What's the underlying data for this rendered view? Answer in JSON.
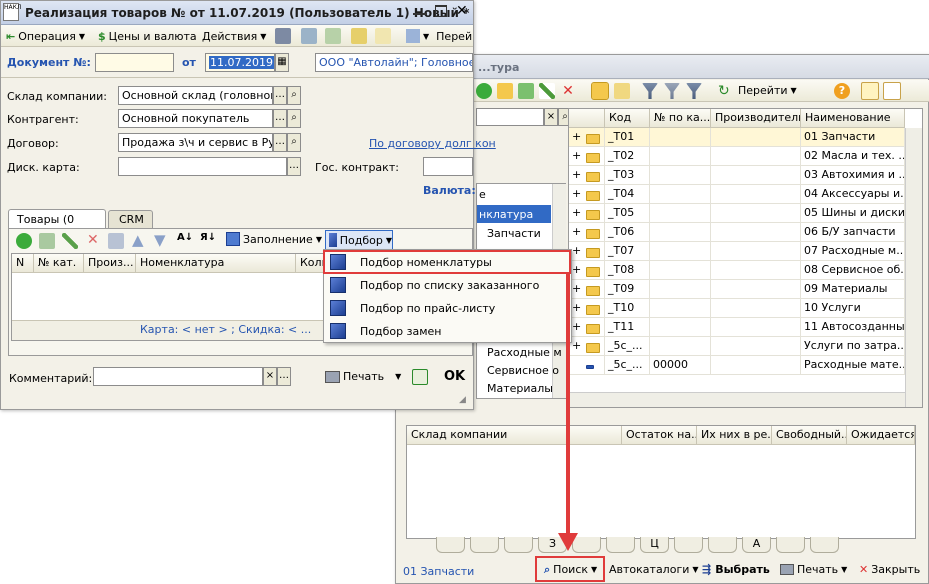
{
  "doc": {
    "title": "Реализация товаров №  от 11.07.2019 (Пользователь 1) Новый *",
    "toolbar": {
      "operation": "Операция",
      "prices": "Цены и валюта",
      "actions": "Действия",
      "goto": "Перей"
    },
    "number_label": "Документ №:",
    "date_label": "от",
    "date_value": "11.07.2019",
    "org_value": "ООО \"Автолайн\"; Головное по",
    "warehouse_label": "Склад компании:",
    "warehouse_value": "Основной склад (головной)",
    "contractor_label": "Контрагент:",
    "contractor_value": "Основной покупатель",
    "contract_label": "Договор:",
    "contract_value": "Продажа з\\ч и сервис в Руб о",
    "contract_link": "По договору долг кон",
    "card_label": "Диск. карта:",
    "gov_label": "Гос. контракт:",
    "currency_label": "Валюта:",
    "tabs": {
      "goods": "Товары (0 поз.)",
      "crm": "CRM"
    },
    "grid_toolbar": {
      "fill": "Заполнение",
      "pick": "Подбор"
    },
    "columns": {
      "n": "N",
      "cat": "№ кат.",
      "maker": "Произ...",
      "item": "Номенклатура",
      "qty": "Коли"
    },
    "footer_info": "Карта:  < нет > ; Скидка:  < ...",
    "comment_label": "Комментарий:",
    "print_label": "Печать",
    "ok_label": "OK"
  },
  "menu": {
    "items": [
      "Подбор номенклатуры",
      "Подбор по списку заказанного",
      "Подбор по прайс-листу",
      "Подбор замен"
    ]
  },
  "catalog": {
    "title": "...тура",
    "toolbar": {
      "goto": "Перейти"
    },
    "tree_items": [
      "нклатура",
      "Запчасти",
      "Расходные м",
      "Сервисное о",
      "Материалы"
    ],
    "tree_header_fragment": "е",
    "columns": {
      "code": "Код",
      "cat": "№ по ка...",
      "maker": "Производитель",
      "name": "Наименование"
    },
    "rows": [
      {
        "code": "_T01",
        "cat": "",
        "name": "01 Запчасти"
      },
      {
        "code": "_T02",
        "cat": "",
        "name": "02 Масла и тех. ..."
      },
      {
        "code": "_T03",
        "cat": "",
        "name": "03 Автохимия и ..."
      },
      {
        "code": "_T04",
        "cat": "",
        "name": "04 Аксессуары и..."
      },
      {
        "code": "_T05",
        "cat": "",
        "name": "05 Шины и диски"
      },
      {
        "code": "_T06",
        "cat": "",
        "name": "06 Б/У запчасти"
      },
      {
        "code": "_T07",
        "cat": "",
        "name": "07 Расходные м..."
      },
      {
        "code": "_T08",
        "cat": "",
        "name": "08 Сервисное об..."
      },
      {
        "code": "_T09",
        "cat": "",
        "name": "09 Материалы"
      },
      {
        "code": "_T10",
        "cat": "",
        "name": "10 Услуги"
      },
      {
        "code": "_T11",
        "cat": "",
        "name": "11 Автосозданные"
      },
      {
        "code": "_5c_...",
        "cat": "",
        "name": "Услуги по затра..."
      },
      {
        "code": "_5c_...",
        "cat": "00000",
        "name": "Расходные мате..."
      }
    ],
    "stock_columns": {
      "warehouse": "Склад компании",
      "rest": "Остаток на...",
      "reserve": "Их них в ре...",
      "free": "Свободный...",
      "expected": "Ожидается"
    },
    "alphabet": [
      "",
      "",
      "",
      "З",
      "",
      "",
      "Ц",
      "",
      "",
      "А",
      "",
      ""
    ],
    "status_path": "01 Запчасти",
    "footer": {
      "search": "Поиск",
      "autocat": "Автокаталоги",
      "choose": "Выбрать",
      "print": "Печать",
      "close": "Закрыть"
    }
  },
  "colors": {
    "accent_red": "#e03b3b",
    "link_blue": "#2554b0",
    "selection": "#316ac5"
  }
}
